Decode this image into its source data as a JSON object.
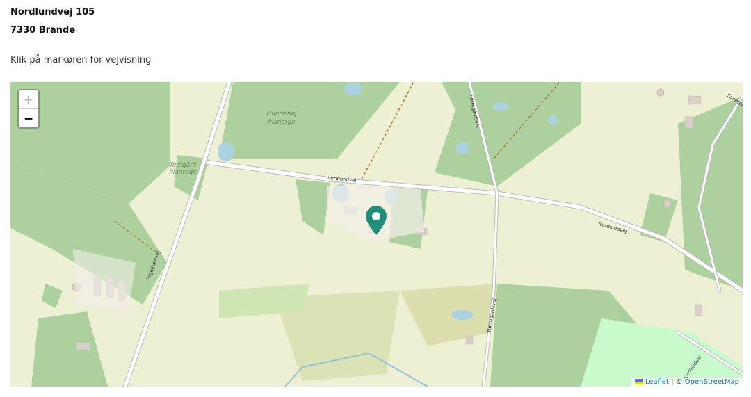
{
  "address": {
    "street": "Nordlundvej 105",
    "city": "7330 Brande"
  },
  "hint": "Klik på markøren for vejvisning",
  "map": {
    "zoom_in": "+",
    "zoom_out": "−",
    "labels": {
      "forest1": "Hundehøj",
      "forest1b": "Plantage",
      "forest2": "Teglgård",
      "forest2b": "Plantage",
      "road1": "Nordlundvej",
      "road2": "Nordlundvej",
      "road3": "Ergelbækvej",
      "road4": "Nørregårdsvej",
      "road5": "Nørregårdsvej",
      "road6": "Sandfelt",
      "road7": "Nordlundvej"
    },
    "attribution": {
      "leaflet": "Leaflet",
      "separator": " | © ",
      "osm": "OpenStreetMap"
    },
    "colors": {
      "forest": "#add19e",
      "farmland": "#eef0d4",
      "water": "#aad3df",
      "marker": "#1f8f7a"
    }
  }
}
